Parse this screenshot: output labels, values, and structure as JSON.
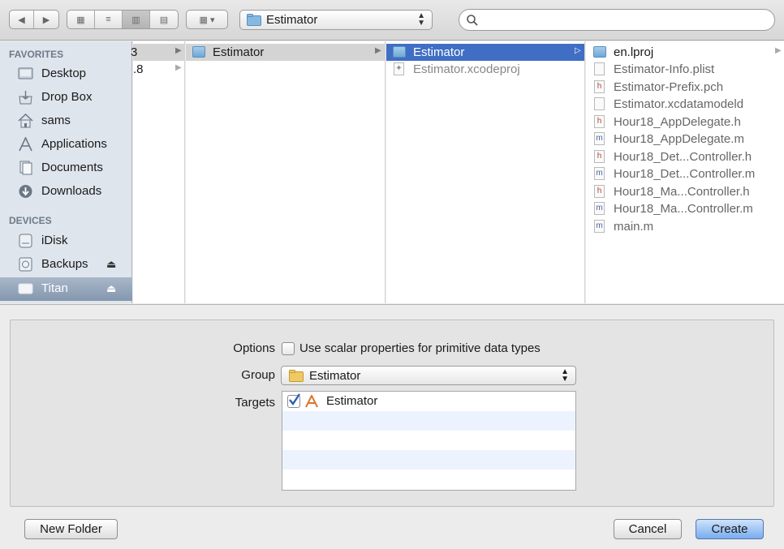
{
  "toolbar": {
    "view_buttons": [
      "icon-view-icon",
      "list-view-icon",
      "column-view-icon",
      "coverflow-view-icon"
    ],
    "location_label": "Estimator",
    "search_placeholder": ""
  },
  "sidebar": {
    "favorites_heading": "FAVORITES",
    "favorites": [
      {
        "label": "Desktop",
        "icon": "desktop-icon"
      },
      {
        "label": "Drop Box",
        "icon": "dropbox-icon"
      },
      {
        "label": "sams",
        "icon": "home-icon"
      },
      {
        "label": "Applications",
        "icon": "applications-icon"
      },
      {
        "label": "Documents",
        "icon": "documents-icon"
      },
      {
        "label": "Downloads",
        "icon": "downloads-icon"
      }
    ],
    "devices_heading": "DEVICES",
    "devices": [
      {
        "label": "iDisk",
        "icon": "idisk-icon"
      },
      {
        "label": "Backups",
        "icon": "backup-drive-icon"
      },
      {
        "label": "Titan",
        "icon": "drive-icon"
      }
    ]
  },
  "columns": {
    "col0": [
      "3",
      ".8"
    ],
    "col1": [
      "Estimator"
    ],
    "col2": [
      "Estimator",
      "Estimator.xcodeproj"
    ],
    "col3": [
      {
        "label": "en.lproj",
        "type": "folder"
      },
      {
        "label": "Estimator-Info.plist",
        "type": "plist"
      },
      {
        "label": "Estimator-Prefix.pch",
        "type": "h"
      },
      {
        "label": "Estimator.xcdatamodeld",
        "type": "data"
      },
      {
        "label": "Hour18_AppDelegate.h",
        "type": "h"
      },
      {
        "label": "Hour18_AppDelegate.m",
        "type": "m"
      },
      {
        "label": "Hour18_Det...Controller.h",
        "type": "h"
      },
      {
        "label": "Hour18_Det...Controller.m",
        "type": "m"
      },
      {
        "label": "Hour18_Ma...Controller.h",
        "type": "h"
      },
      {
        "label": "Hour18_Ma...Controller.m",
        "type": "m"
      },
      {
        "label": "main.m",
        "type": "m"
      }
    ]
  },
  "options": {
    "options_label": "Options",
    "scalar_label": "Use scalar properties for primitive data types",
    "scalar_checked": false,
    "group_label": "Group",
    "group_value": "Estimator",
    "targets_label": "Targets",
    "target_name": "Estimator",
    "target_checked": true
  },
  "buttons": {
    "new_folder": "New Folder",
    "cancel": "Cancel",
    "create": "Create"
  },
  "colors": {
    "selection": "#3f6ec4",
    "sidebar": "#dfe5ed"
  }
}
